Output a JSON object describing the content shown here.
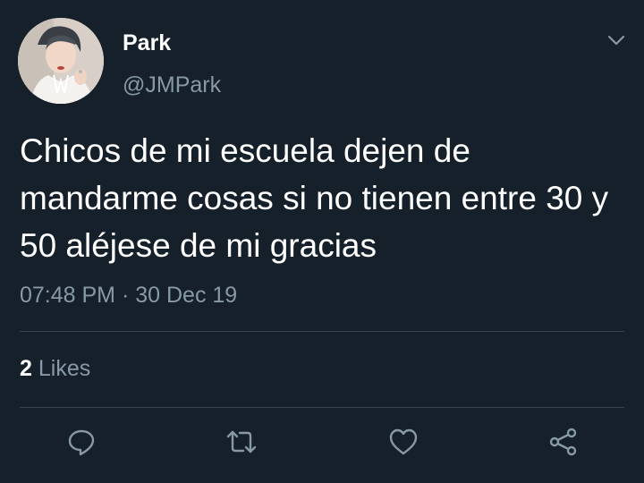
{
  "user": {
    "display_name": "Park",
    "handle": "@JMPark"
  },
  "tweet": {
    "text": "Chicos de mi escuela dejen de mandarme cosas si no tienen entre 30 y 50 aléjese de mi gracias",
    "time": "07:48 PM",
    "separator": "·",
    "date": "30 Dec 19"
  },
  "stats": {
    "likes_count": "2",
    "likes_label": "Likes"
  },
  "icons": {
    "menu": "chevron-down-icon",
    "reply": "reply-icon",
    "retweet": "retweet-icon",
    "like": "heart-icon",
    "share": "share-icon"
  },
  "colors": {
    "background": "#15202b",
    "secondary_text": "#8899a6",
    "divider": "#38444d",
    "primary_text": "#ffffff"
  }
}
